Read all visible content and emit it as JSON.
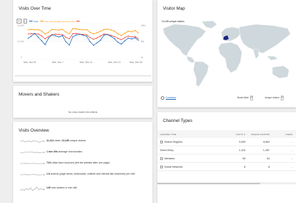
{
  "visits_over_time": {
    "title": "Visits Over Time",
    "legend": [
      {
        "label": "Visits",
        "color": "#1565c0"
      },
      {
        "label": "Avg. Visit Duration (in seconds)",
        "color": "#ff9800"
      },
      {
        "label": "...",
        "color": "#f44336"
      }
    ],
    "left_axis": [
      "23,200",
      "11,600",
      "0"
    ],
    "right_axis": [
      "159s",
      "80s",
      "0s"
    ],
    "x_labels": [
      "Mon, Nov 30",
      "Mon, Dec 7",
      "Mon, Dec 14",
      "Mon, Dec 21",
      "Mon, Dec 28"
    ],
    "series": {
      "visits": [
        13200,
        14800,
        16500,
        14200,
        12000,
        9400,
        13500,
        15600,
        15000,
        14300,
        15100,
        11200,
        9200,
        14500,
        15500,
        16000,
        15300,
        14800,
        11200,
        9000,
        10600,
        12200,
        15500,
        15800,
        14700,
        13200,
        11000,
        9800,
        11800,
        13600,
        13000,
        13800,
        12100
      ],
      "avg_duration": [
        128,
        131,
        129,
        130,
        124,
        111,
        118,
        131,
        129,
        128,
        131,
        119,
        112,
        134,
        133,
        130,
        129,
        130,
        118,
        111,
        116,
        123,
        130,
        132,
        128,
        123,
        112,
        104,
        114,
        123,
        120,
        126,
        114
      ],
      "third": [
        111,
        112,
        112,
        111,
        102,
        90,
        100,
        108,
        110,
        109,
        108,
        97,
        90,
        112,
        113,
        110,
        109,
        108,
        95,
        88,
        94,
        102,
        111,
        109,
        105,
        100,
        92,
        86,
        95,
        102,
        98,
        100,
        90
      ]
    }
  },
  "movers": {
    "title": "Movers and Shakers",
    "empty_message": "No rows match the criteria"
  },
  "overview": {
    "title": "Visits Overview",
    "rows": [
      {
        "bold": "11,012",
        "text": " visits, ",
        "bold2": "10,189",
        "text2": " unique visitors"
      },
      {
        "bold": "1 min 49s",
        "text": " average visit duration",
        "bold2": "",
        "text2": ""
      },
      {
        "bold": "74%",
        "text": " visits have bounced (left the website after one page)",
        "bold2": "",
        "text2": ""
      },
      {
        "bold": "1.8",
        "text": " actions (page views, downloads, outlinks and internal site searches) per visit",
        "bold2": "",
        "text2": ""
      },
      {
        "bold": "149",
        "text": " max actions in one visit",
        "bold2": "",
        "text2": ""
      }
    ]
  },
  "visitor_map": {
    "title": "Visitor Map",
    "subtitle": "10,189 unique visitors",
    "radio_label": "Countries",
    "region_select": "World-Wide",
    "metric_select": "Unique visitors",
    "land_color": "#cfd8dc",
    "water_color": "#ffffff",
    "highlight_color": "#1a237e"
  },
  "channels": {
    "title": "Channel Types",
    "headers": {
      "type": "CHANNEL TYPE",
      "visits": "VISITS",
      "unique": "UNIQUE VISITORS",
      "users": "USERS"
    },
    "sort_indicator": "▼",
    "rows": [
      {
        "label": "Search Engines",
        "visits": "9,539",
        "unique": "8,962",
        "users": "-",
        "expand": true
      },
      {
        "label": "Direct Entry",
        "visits": "1,410",
        "unique": "1,287",
        "users": "-",
        "expand": false
      },
      {
        "label": "Websites",
        "visits": "55",
        "unique": "54",
        "users": "-",
        "expand": true
      },
      {
        "label": "Social Networks",
        "visits": "8",
        "unique": "8",
        "users": "-",
        "expand": true
      }
    ]
  }
}
